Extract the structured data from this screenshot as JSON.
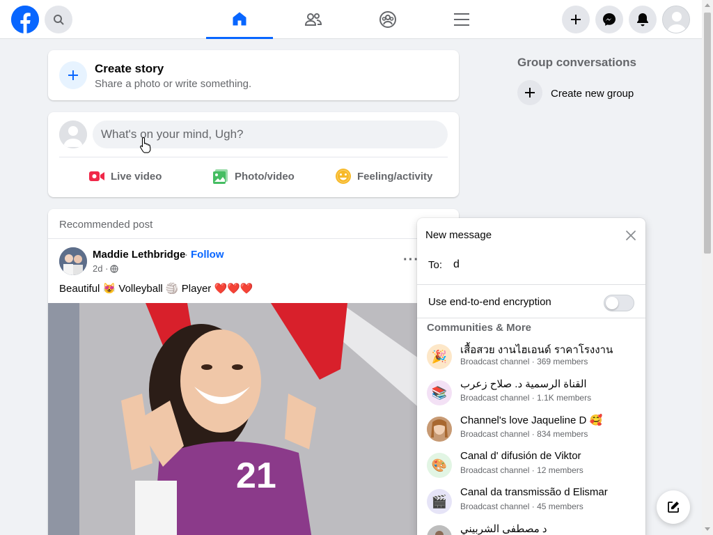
{
  "colors": {
    "brand": "#0866ff",
    "text_secondary": "#65676b",
    "background": "#f0f2f5"
  },
  "topbar": {
    "logo_icon": "facebook-logo",
    "search_icon": "search-icon",
    "nav": [
      {
        "name": "home-icon",
        "active": true
      },
      {
        "name": "friends-icon",
        "active": false
      },
      {
        "name": "groups-icon",
        "active": false
      },
      {
        "name": "menu-icon",
        "active": false
      }
    ],
    "actions": [
      "plus-icon",
      "messenger-icon",
      "bell-icon",
      "avatar"
    ]
  },
  "story": {
    "title": "Create story",
    "subtitle": "Share a photo or write something."
  },
  "composer": {
    "placeholder": "What's on your mind, Ugh?",
    "actions": [
      {
        "label": "Live video",
        "icon": "live-video-icon",
        "color": "#f02849"
      },
      {
        "label": "Photo/video",
        "icon": "photo-icon",
        "color": "#45bd62"
      },
      {
        "label": "Feeling/activity",
        "icon": "feeling-icon",
        "color": "#f7b928"
      }
    ]
  },
  "post": {
    "recommended_label": "Recommended post",
    "author": "Maddie Lethbridge",
    "separator": "·",
    "follow_label": "Follow",
    "time": "2d ·",
    "more": "···",
    "text": "Beautiful 😻 Volleyball 🏐 Player ❤️❤️❤️",
    "jersey_number": "21"
  },
  "group_conversations": {
    "title": "Group conversations",
    "create_label": "Create new group"
  },
  "new_message": {
    "title": "New message",
    "to_label": "To:",
    "to_value": "d",
    "encryption_label": "Use end-to-end encryption",
    "encryption_on": false,
    "section_title": "Communities & More",
    "items": [
      {
        "name": "เสื้อสวย งานไฮเอนด์ ราคาโรงงาน",
        "sub": "Broadcast channel · 369 members",
        "icon": "🎉",
        "bg": "#fde7c8"
      },
      {
        "name": "القناة الرسمية د. صلاح زعرب",
        "sub": "Broadcast channel · 1.1K members",
        "icon": "📚",
        "bg": "#f3e1f5"
      },
      {
        "name": "Channel's love Jaqueline D 🥰",
        "sub": "Broadcast channel · 834 members",
        "icon": "",
        "bg": "#e8c6a8"
      },
      {
        "name": "Canal d' difusión de Viktor",
        "sub": "Broadcast channel · 12 members",
        "icon": "🎨",
        "bg": "#e2f5e4"
      },
      {
        "name": "Canal da transmissão d Elismar",
        "sub": "Broadcast channel · 45 members",
        "icon": "🎬",
        "bg": "#e6e4f7"
      },
      {
        "name": "د مصطفى الشربيني",
        "sub": "",
        "icon": "",
        "bg": "#c9c9c9"
      }
    ]
  }
}
